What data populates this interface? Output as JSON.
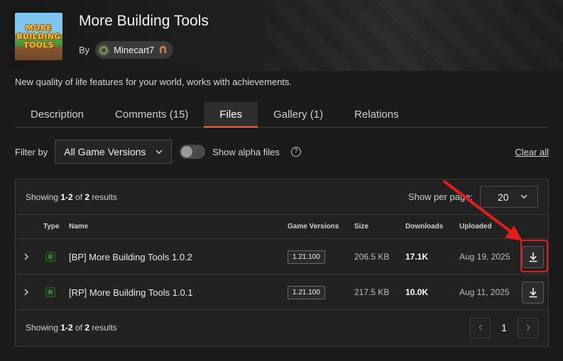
{
  "project": {
    "title": "More Building Tools",
    "logo_lines": [
      "MORE",
      "BUILDING",
      "TOOLS"
    ],
    "by_label": "By",
    "author": "Minecart7",
    "description": "New quality of life features for your world, works with achievements."
  },
  "tabs": [
    {
      "label": "Description",
      "active": false
    },
    {
      "label": "Comments (15)",
      "active": false
    },
    {
      "label": "Files",
      "active": true
    },
    {
      "label": "Gallery (1)",
      "active": false
    },
    {
      "label": "Relations",
      "active": false
    }
  ],
  "filters": {
    "filter_label": "Filter by",
    "game_versions_value": "All Game Versions",
    "alpha_label": "Show alpha files",
    "alpha_enabled": false,
    "clear_label": "Clear all"
  },
  "results": {
    "showing_prefix": "Showing ",
    "range": "1-2",
    "of": " of ",
    "total": "2",
    "suffix": " results",
    "per_page_label": "Show per page:",
    "per_page_value": "20"
  },
  "columns": {
    "type": "Type",
    "name": "Name",
    "game_versions": "Game Versions",
    "size": "Size",
    "downloads": "Downloads",
    "uploaded": "Uploaded"
  },
  "files": [
    {
      "type": "R",
      "name": "[BP] More Building Tools 1.0.2",
      "version": "1.21.100",
      "size": "206.5 KB",
      "downloads": "17.1K",
      "uploaded": "Aug 19, 2025"
    },
    {
      "type": "R",
      "name": "[RP] More Building Tools 1.0.1",
      "version": "1.21.100",
      "size": "217.5 KB",
      "downloads": "10.0K",
      "uploaded": "Aug 11, 2025"
    }
  ],
  "pagination": {
    "current": "1"
  },
  "colors": {
    "accent": "#f16436",
    "highlight": "#e21b1b",
    "background": "#1b1b1b"
  }
}
